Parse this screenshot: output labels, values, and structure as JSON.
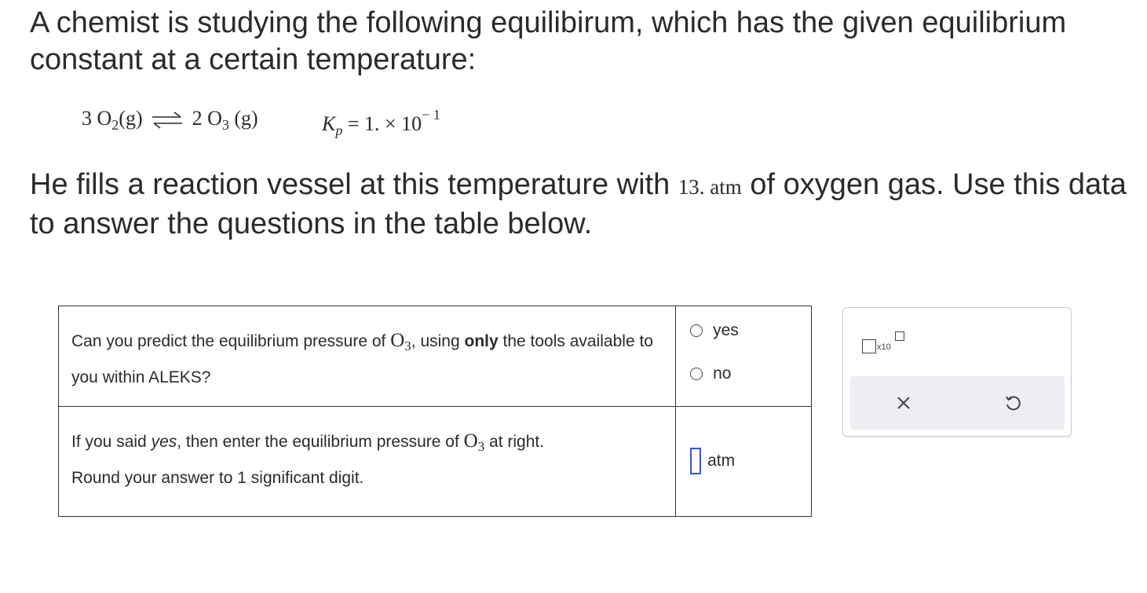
{
  "intro": "A chemist is studying the following equilibirum, which has the given equilibrium constant at a certain temperature:",
  "equation": {
    "reactant_coef": "3",
    "reactant_base": "O",
    "reactant_sub": "2",
    "reactant_state": "(g)",
    "product_coef": "2",
    "product_base": "O",
    "product_sub": "3",
    "product_state": "(g)",
    "k_symbol": "K",
    "k_sub": "p",
    "k_value": "= 1. × 10",
    "k_exp": "− 1"
  },
  "paragraph": {
    "before": "He fills a reaction vessel at this temperature with ",
    "value": "13. atm",
    "after": " of oxygen gas. Use this data to answer the questions in the table below."
  },
  "table": {
    "q1": {
      "part1": "Can you predict the equilibrium pressure of ",
      "species_base": "O",
      "species_sub": "3",
      "part2": ", using ",
      "bold": "only",
      "part3": " the tools available to you within ALEKS?",
      "options": [
        "yes",
        "no"
      ]
    },
    "q2": {
      "part1": "If you said ",
      "italic": "yes",
      "part2": ", then enter the equilibrium pressure of ",
      "species_base": "O",
      "species_sub": "3",
      "part3": " at right.",
      "line2": "Round your answer to 1 significant digit.",
      "unit": "atm"
    }
  },
  "toolbox": {
    "sci_label": "x10",
    "icons": [
      "scientific-notation-icon",
      "clear-x-icon",
      "undo-icon"
    ]
  },
  "colors": {
    "text": "#2b2b2b",
    "input_border": "#3557c8",
    "toolbar_bg": "#eceef1"
  }
}
